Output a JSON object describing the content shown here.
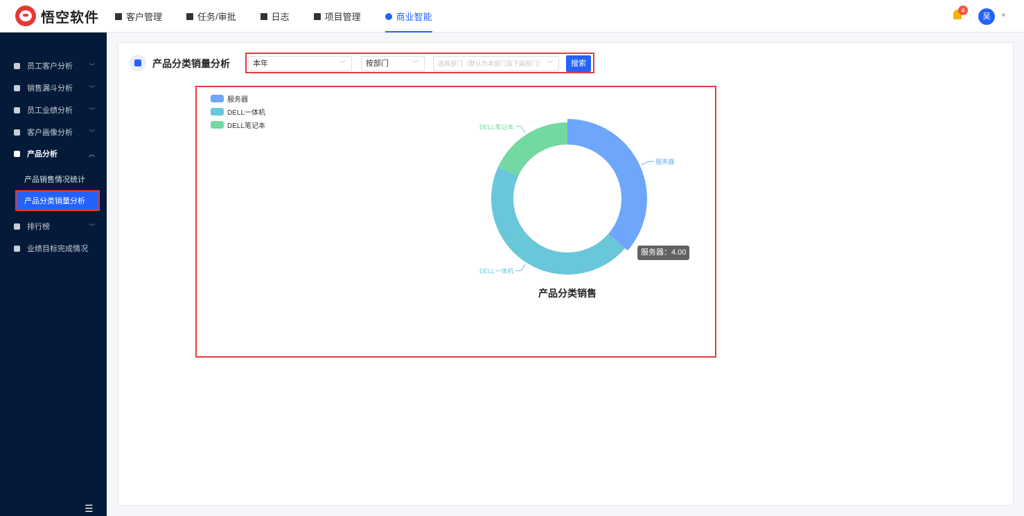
{
  "app": {
    "name": "悟空软件"
  },
  "nav": [
    {
      "label": "客户管理",
      "active": false
    },
    {
      "label": "任务/审批",
      "active": false
    },
    {
      "label": "日志",
      "active": false
    },
    {
      "label": "项目管理",
      "active": false
    },
    {
      "label": "商业智能",
      "active": true
    }
  ],
  "notifications": {
    "count": "4"
  },
  "user": {
    "avatar_text": "吴"
  },
  "sidebar": {
    "items": [
      {
        "label": "员工客户分析",
        "icon": "user-icon"
      },
      {
        "label": "销售漏斗分析",
        "icon": "funnel-icon"
      },
      {
        "label": "员工业绩分析",
        "icon": "bar-chart-icon"
      },
      {
        "label": "客户画像分析",
        "icon": "users-icon"
      },
      {
        "label": "产品分析",
        "icon": "cube-icon"
      },
      {
        "label": "排行榜",
        "icon": "trophy-icon"
      },
      {
        "label": "业绩目标完成情况",
        "icon": "target-icon"
      }
    ],
    "sub_items": [
      {
        "label": "产品销售情况统计"
      },
      {
        "label": "产品分类销量分析"
      }
    ]
  },
  "page": {
    "title": "产品分类销量分析",
    "filters": {
      "period": "本年",
      "scope": "按部门",
      "dept_placeholder": "选择部门（默认为本部门及下属部门）",
      "search_label": "搜索"
    }
  },
  "chart_data": {
    "type": "pie",
    "title": "产品分类销售",
    "categories": [
      "服务器",
      "DELL一体机",
      "DELL笔记本"
    ],
    "values": [
      4,
      5,
      2
    ],
    "colors": [
      "#6ea6fb",
      "#69c7d9",
      "#74d8a2"
    ],
    "legend_position": "top-left",
    "tooltip": "服务器：4.00"
  }
}
